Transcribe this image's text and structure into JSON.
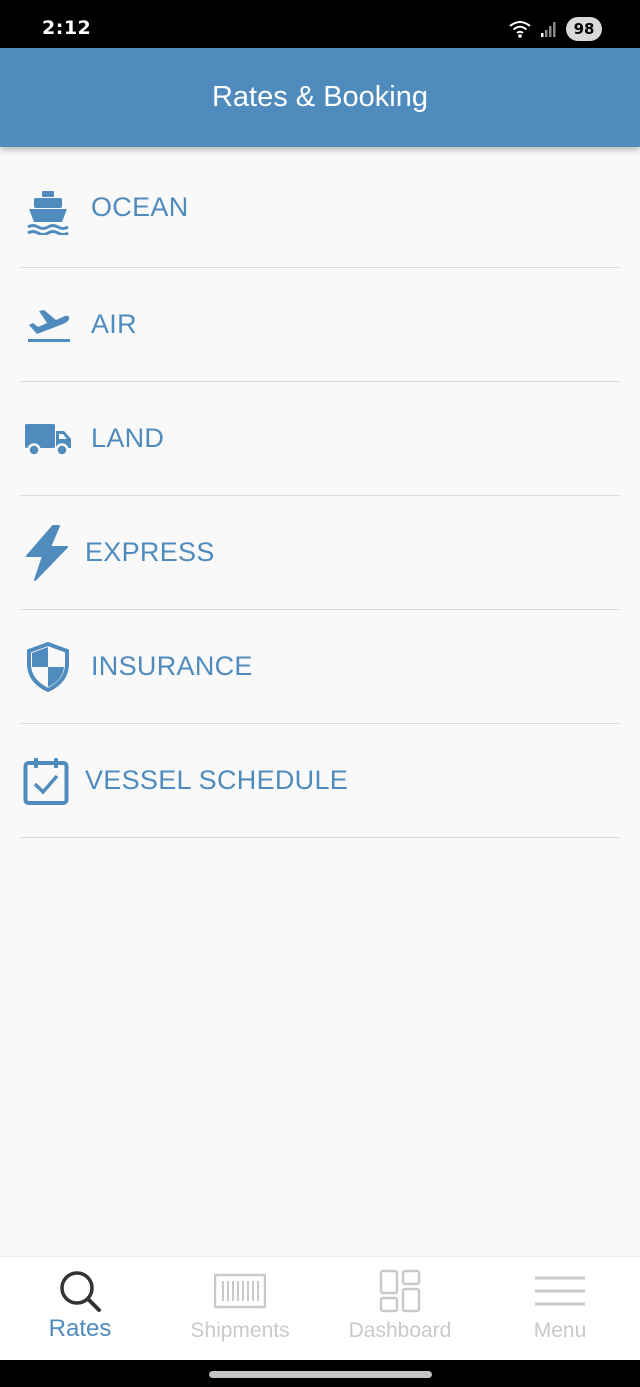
{
  "status_bar": {
    "time": "2:12",
    "battery": "98"
  },
  "app_bar": {
    "title": "Rates & Booking"
  },
  "menu": {
    "items": [
      {
        "label": "OCEAN",
        "icon": "ship-icon"
      },
      {
        "label": "AIR",
        "icon": "airplane-takeoff-icon"
      },
      {
        "label": "LAND",
        "icon": "truck-icon"
      },
      {
        "label": "EXPRESS",
        "icon": "lightning-bolt-icon"
      },
      {
        "label": "INSURANCE",
        "icon": "shield-icon"
      },
      {
        "label": "VESSEL SCHEDULE",
        "icon": "calendar-check-icon"
      }
    ]
  },
  "bottom_nav": {
    "items": [
      {
        "label": "Rates",
        "icon": "search-icon",
        "active": true
      },
      {
        "label": "Shipments",
        "icon": "container-icon",
        "active": false
      },
      {
        "label": "Dashboard",
        "icon": "dashboard-icon",
        "active": false
      },
      {
        "label": "Menu",
        "icon": "hamburger-menu-icon",
        "active": false
      }
    ]
  },
  "colors": {
    "primary": "#4f8bbd",
    "inactive": "#c9c9c9",
    "background": "#f9f9f9"
  }
}
